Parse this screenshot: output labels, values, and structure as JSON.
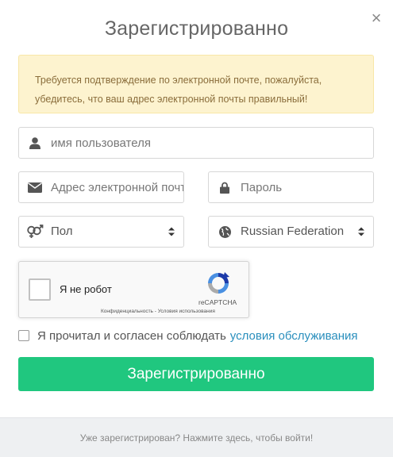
{
  "modal": {
    "title": "Зарегистрированно",
    "close_label": "×"
  },
  "alert": {
    "line1": "Требуется подтверждение по электронной почте, пожалуйста,",
    "line2": "убедитесь, что ваш адрес электронной почты правильный!",
    "color": "#fdf3cf"
  },
  "form": {
    "username": {
      "placeholder": "имя пользователя",
      "icon": "user-icon"
    },
    "email": {
      "placeholder": "Адрес электронной почты",
      "icon": "envelope-icon"
    },
    "password": {
      "placeholder": "Пароль",
      "icon": "lock-icon"
    },
    "gender": {
      "value": "Пол",
      "icon": "gender-icon"
    },
    "country": {
      "value": "Russian Federation",
      "icon": "globe-icon"
    }
  },
  "captcha": {
    "label": "Я не робот",
    "brand": "reCAPTCHA",
    "links": "Конфиденциальность - Условия использования"
  },
  "terms": {
    "text": "Я прочитал и согласен соблюдать",
    "link": "условия обслуживания",
    "link_color": "#2a8fbd"
  },
  "submit": {
    "label": "Зарегистрированно",
    "color": "#20c77f"
  },
  "footer": {
    "text": "Уже зарегистрирован? Нажмите здесь, чтобы войти!"
  }
}
